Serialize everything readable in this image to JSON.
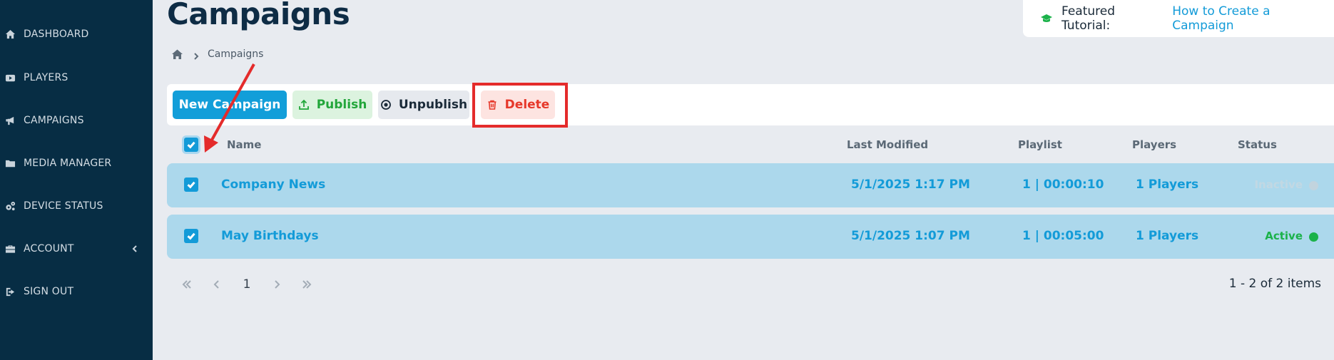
{
  "sidebar": {
    "items": [
      {
        "label": "DASHBOARD",
        "icon": "home-icon"
      },
      {
        "label": "PLAYERS",
        "icon": "player-icon"
      },
      {
        "label": "CAMPAIGNS",
        "icon": "megaphone-icon"
      },
      {
        "label": "MEDIA MANAGER",
        "icon": "folder-icon"
      },
      {
        "label": "DEVICE STATUS",
        "icon": "gears-icon"
      },
      {
        "label": "ACCOUNT",
        "icon": "briefcase-icon"
      },
      {
        "label": "SIGN OUT",
        "icon": "sign-out-icon"
      }
    ]
  },
  "header": {
    "title": "Campaigns",
    "tutorial_label": "Featured Tutorial:",
    "tutorial_link": "How to Create a Campaign"
  },
  "breadcrumb": {
    "current": "Campaigns"
  },
  "toolbar": {
    "new_label": "New Campaign",
    "publish_label": "Publish",
    "unpublish_label": "Unpublish",
    "delete_label": "Delete"
  },
  "table": {
    "columns": {
      "name": "Name",
      "last_modified": "Last Modified",
      "playlist": "Playlist",
      "players": "Players",
      "status": "Status"
    },
    "rows": [
      {
        "name": "Company News",
        "last_modified": "5/1/2025 1:17 PM",
        "playlist": "1 | 00:00:10",
        "players": "1 Players",
        "status": "Inactive",
        "checked": true
      },
      {
        "name": "May Birthdays",
        "last_modified": "5/1/2025 1:07 PM",
        "playlist": "1 | 00:05:00",
        "players": "1 Players",
        "status": "Active",
        "checked": true
      }
    ]
  },
  "pagination": {
    "page": "1",
    "summary": "1 - 2 of 2 items"
  },
  "colors": {
    "sidebar_bg": "#072d44",
    "accent": "#139bd8",
    "active_green": "#1bb24a",
    "delete_red": "#e6382a",
    "row_selected": "#acd8ec"
  }
}
